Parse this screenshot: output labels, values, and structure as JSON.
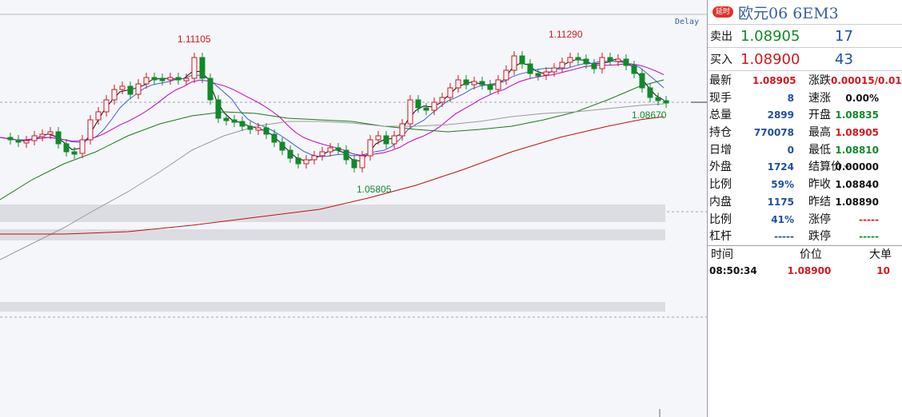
{
  "header": {
    "badge": "延时",
    "title": "欧元06  6EM3"
  },
  "chart_flag": "Delay",
  "annotations": {
    "high1": "1.11105",
    "high2": "1.11290",
    "low": "1.05805",
    "last": "1.08670"
  },
  "quotes": [
    {
      "label": "卖出",
      "price": "1.08905",
      "vol": "17",
      "color": "#0f8a28"
    },
    {
      "label": "买入",
      "price": "1.08900",
      "vol": "43",
      "color": "#d4171f"
    }
  ],
  "stats_left": [
    {
      "label": "最新",
      "value": "1.08905",
      "cls": "red"
    },
    {
      "label": "现手",
      "value": "8",
      "cls": "blue"
    },
    {
      "label": "总量",
      "value": "2899",
      "cls": "blue"
    },
    {
      "label": "持仓",
      "value": "770078",
      "cls": "blue"
    },
    {
      "label": "日增",
      "value": "0",
      "cls": "blue"
    },
    {
      "label": "外盘",
      "value": "1724",
      "cls": "blue"
    },
    {
      "label": "比例",
      "value": "59%",
      "cls": "blue"
    },
    {
      "label": "内盘",
      "value": "1175",
      "cls": "blue"
    },
    {
      "label": "比例",
      "value": "41%",
      "cls": "blue"
    },
    {
      "label": "杠杆",
      "value": "-----",
      "cls": "blue"
    }
  ],
  "stats_right": [
    {
      "label": "涨跌",
      "value": "0.00015/0.01%",
      "cls": "red"
    },
    {
      "label": "速涨",
      "value": "0.00%",
      "cls": "dark"
    },
    {
      "label": "开盘",
      "value": "1.08835",
      "cls": "green"
    },
    {
      "label": "最高",
      "value": "1.08905",
      "cls": "red"
    },
    {
      "label": "最低",
      "value": "1.08810",
      "cls": "green"
    },
    {
      "label": "结算价",
      "value": "0.00000",
      "cls": "dark"
    },
    {
      "label": "昨收",
      "value": "1.08840",
      "cls": "dark"
    },
    {
      "label": "昨结",
      "value": "1.08890",
      "cls": "dark"
    },
    {
      "label": "涨停",
      "value": "-----",
      "cls": "red"
    },
    {
      "label": "跌停",
      "value": "-----",
      "cls": "green"
    }
  ],
  "trades": {
    "headers": [
      "时间",
      "价位",
      "大单"
    ],
    "rows": [
      {
        "time": "08:50:34",
        "price": "1.08900",
        "size": "10"
      }
    ]
  },
  "colors": {
    "up": "#d4171f",
    "down": "#0f8a28",
    "ma5": "#111111",
    "ma10": "#3a5fcd",
    "ma20": "#c000c0",
    "ma60": "#1a7a1a",
    "ma120": "#999999",
    "ma250": "#c01010"
  }
}
